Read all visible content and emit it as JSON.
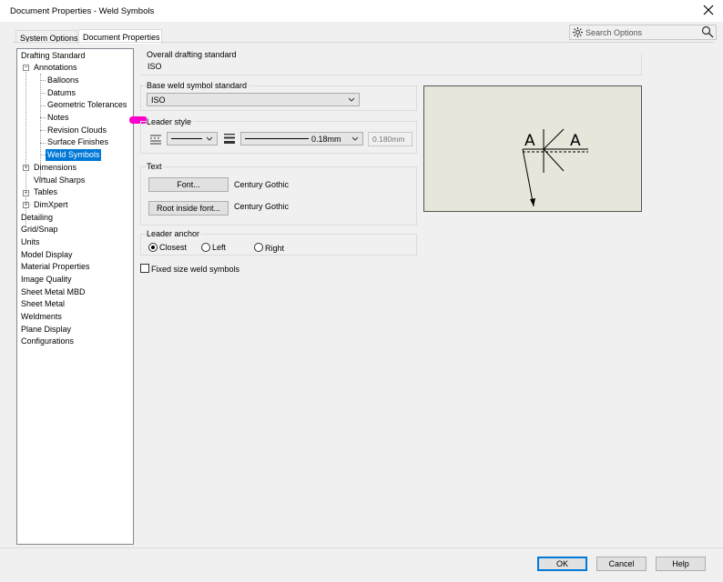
{
  "window": {
    "title": "Document Properties - Weld Symbols"
  },
  "tabs": [
    {
      "label": "System Options",
      "active": false
    },
    {
      "label": "Document Properties",
      "active": true
    }
  ],
  "search": {
    "placeholder": "Search Options"
  },
  "tree": {
    "items": [
      {
        "label": "Drafting Standard"
      },
      {
        "label": "Annotations",
        "expanded": true
      },
      {
        "label": "Balloons"
      },
      {
        "label": "Datums"
      },
      {
        "label": "Geometric Tolerances"
      },
      {
        "label": "Notes"
      },
      {
        "label": "Revision Clouds"
      },
      {
        "label": "Surface Finishes"
      },
      {
        "label": "Weld Symbols",
        "selected": true
      },
      {
        "label": "Dimensions"
      },
      {
        "label": "Virtual Sharps"
      },
      {
        "label": "Tables"
      },
      {
        "label": "DimXpert"
      },
      {
        "label": "Detailing"
      },
      {
        "label": "Grid/Snap"
      },
      {
        "label": "Units"
      },
      {
        "label": "Model Display"
      },
      {
        "label": "Material Properties"
      },
      {
        "label": "Image Quality"
      },
      {
        "label": "Sheet Metal MBD"
      },
      {
        "label": "Sheet Metal"
      },
      {
        "label": "Weldments"
      },
      {
        "label": "Plane Display"
      },
      {
        "label": "Configurations"
      }
    ]
  },
  "overall": {
    "label": "Overall drafting standard",
    "value": "ISO"
  },
  "base_weld": {
    "label": "Base weld symbol standard",
    "value": "ISO"
  },
  "leader_style": {
    "label": "Leader style",
    "thickness": "0.18mm",
    "custom": "0.180mm"
  },
  "text": {
    "label": "Text",
    "font_button": "Font...",
    "font_value": "Century Gothic",
    "root_button": "Root inside font...",
    "root_value": "Century Gothic"
  },
  "leader_anchor": {
    "label": "Leader anchor",
    "options": [
      "Closest",
      "Left",
      "Right"
    ],
    "selected": "Closest"
  },
  "fixed_size": {
    "label": "Fixed size weld symbols",
    "checked": false
  },
  "preview": {
    "left_letter": "A",
    "right_letter": "A"
  },
  "footer": {
    "ok": "OK",
    "cancel": "Cancel",
    "help": "Help"
  },
  "colors": {
    "selection": "#0078d7",
    "pointer": "#ff00cc",
    "preview_bg": "#e6e6da"
  }
}
